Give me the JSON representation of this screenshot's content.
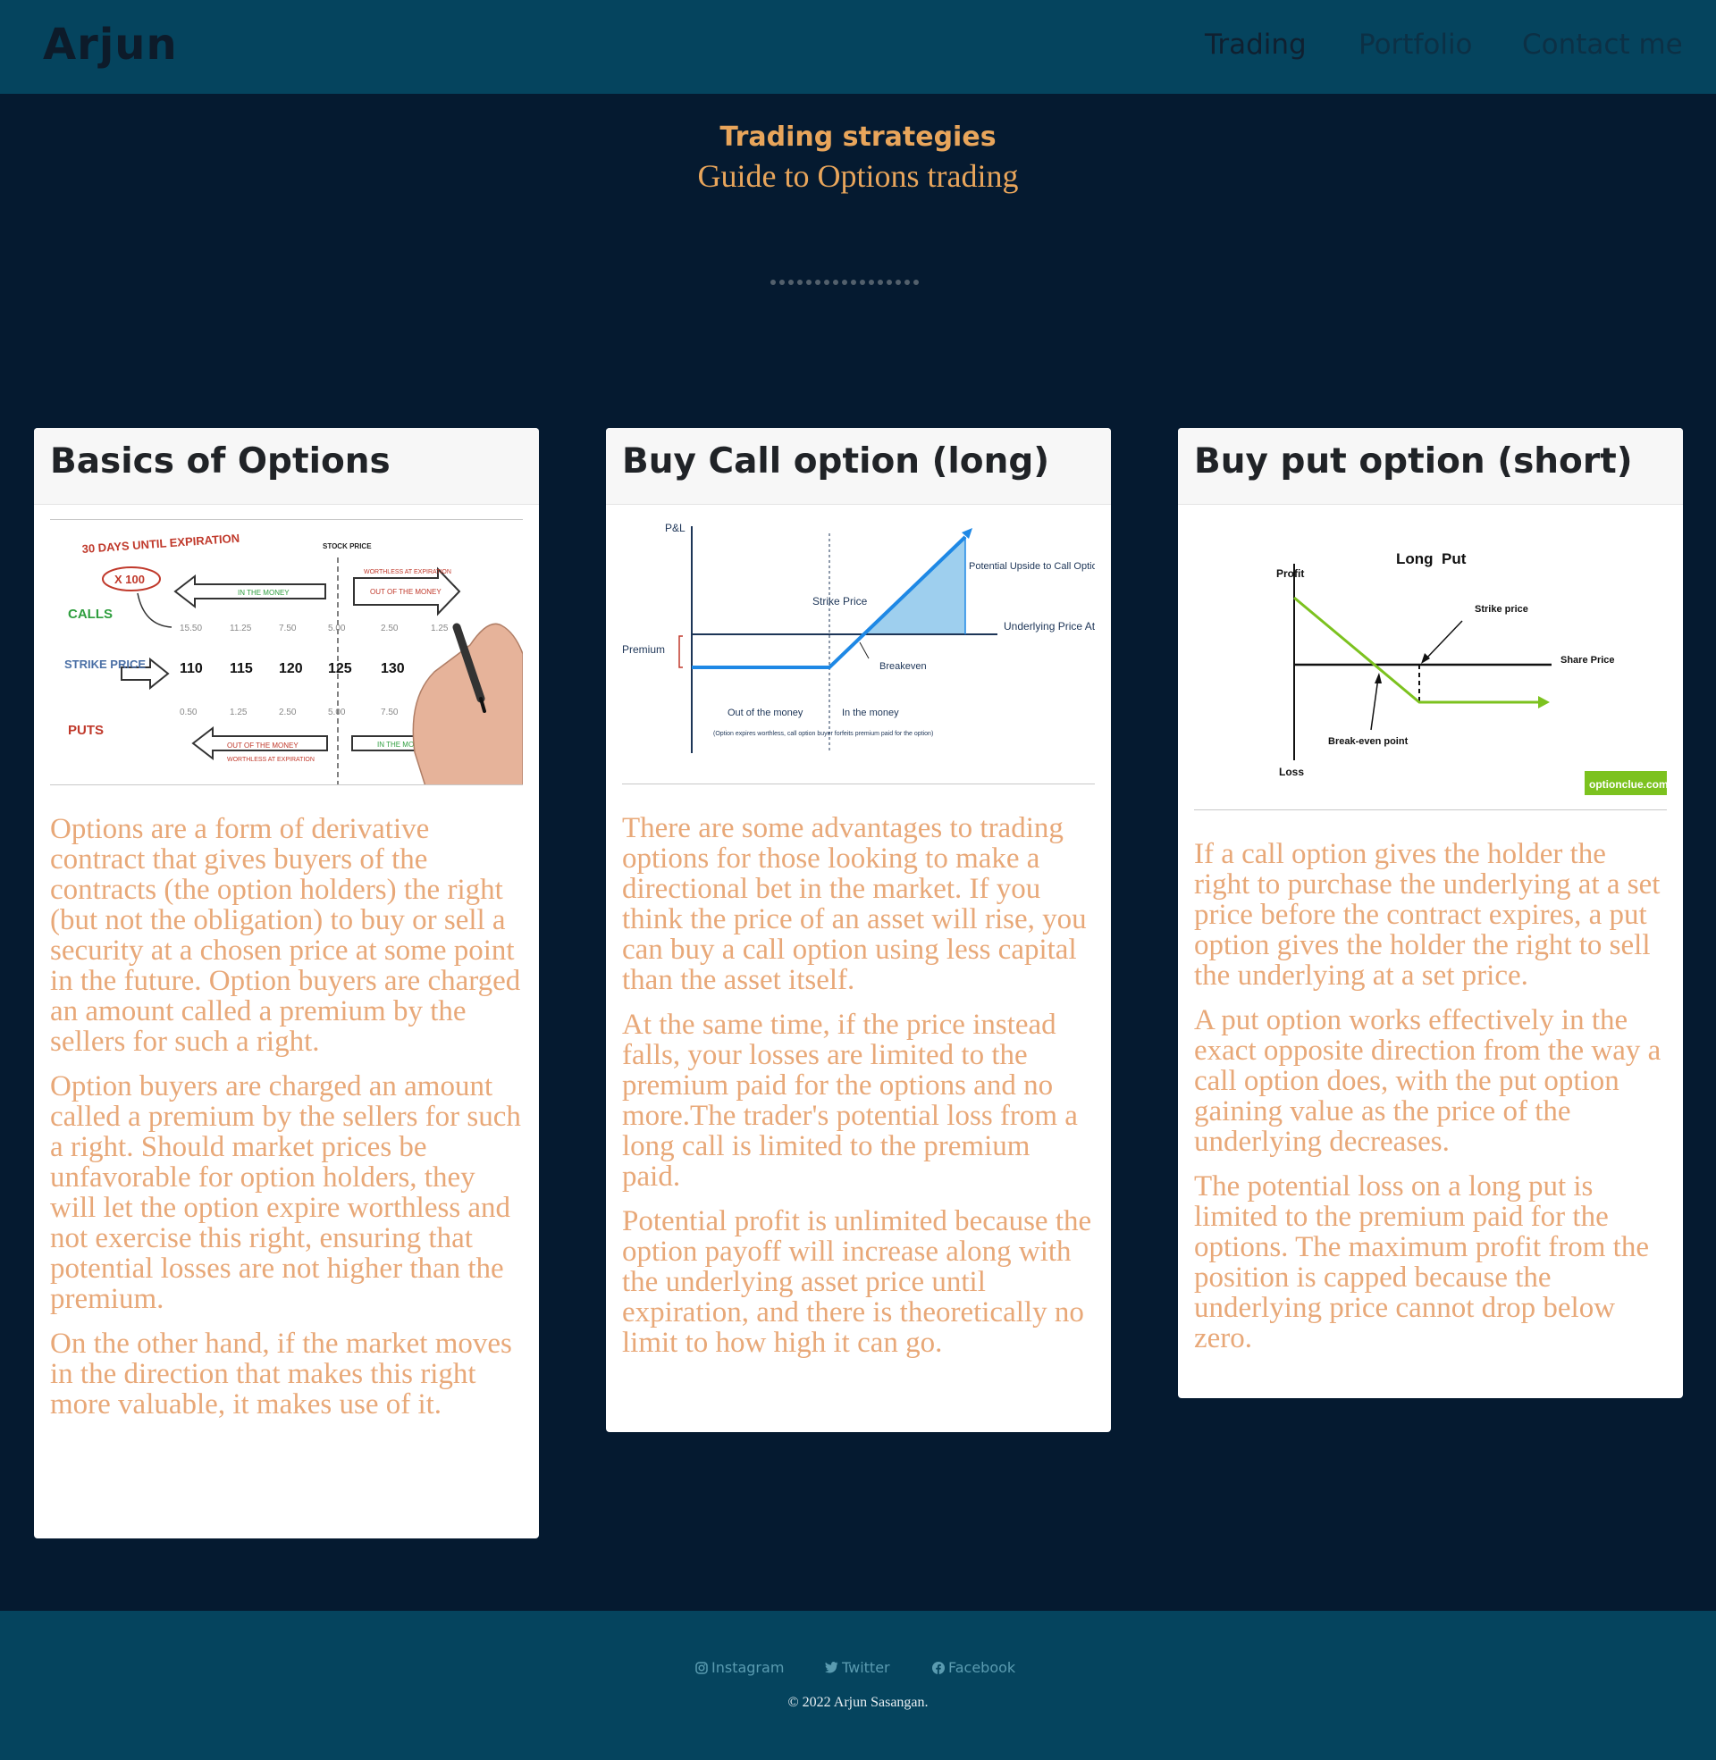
{
  "nav": {
    "brand": "Arjun",
    "links": [
      "Trading",
      "Portfolio",
      "Contact me"
    ]
  },
  "hero": {
    "title": "Trading strategies",
    "subtitle": "Guide to Options trading"
  },
  "cards": [
    {
      "title": "Basics of Options",
      "figure": {
        "heading": "30 DAYS UNTIL EXPIRATION",
        "multiplier": "X 100",
        "stock_price": "STOCK PRICE",
        "calls": "CALLS",
        "strike_price": "STRIKE PRICE",
        "puts": "PUTS",
        "in_the_money": "IN THE MONEY",
        "out_of_the_money": "OUT OF THE MONEY",
        "worthless": "WORTHLESS AT EXPIRATION",
        "call_prices": [
          "15.50",
          "11.25",
          "7.50",
          "5.00",
          "2.50",
          "1.25"
        ],
        "strikes": [
          "110",
          "115",
          "120",
          "125",
          "130"
        ],
        "put_prices": [
          "0.50",
          "1.25",
          "2.50",
          "5.00",
          "7.50"
        ]
      },
      "paragraphs": [
        "Options are a form of derivative contract that gives buyers of the contracts (the option holders) the right (but not the obligation) to buy or sell a security at a chosen price at some point in the future. Option buyers are charged an amount called a premium by the sellers for such a right.",
        "Option buyers are charged an amount called a premium by the sellers for such a right. Should market prices be unfavorable for option holders, they will let the option expire worthless and not exercise this right, ensuring that potential losses are not higher than the premium.",
        "On the other hand, if the market moves in the direction that makes this right more valuable, it makes use of it."
      ]
    },
    {
      "title": "Buy Call option (long)",
      "figure": {
        "pl": "P&L",
        "strike": "Strike Price",
        "premium": "Premium",
        "upside": "Potential Upside to Call Option Buyer",
        "underlying": "Underlying Price At Expiration",
        "breakeven": "Breakeven",
        "otm": "Out of the money",
        "itm": "In the money",
        "note": "(Option expires worthless, call option buyer forfeits premium paid for the option)"
      },
      "paragraphs": [
        "There are some advantages to trading options for those looking to make a directional bet in the market. If you think the price of an asset will rise, you can buy a call option using less capital than the asset itself.",
        "At the same time, if the price instead falls, your losses are limited to the premium paid for the options and no more.The trader's potential loss from a long call is limited to the premium paid.",
        "Potential profit is unlimited because the option payoff will increase along with the underlying asset price until expiration, and there is theoretically no limit to how high it can go."
      ]
    },
    {
      "title": "Buy put option (short)",
      "figure": {
        "title": "Long  Put",
        "profit": "Profit",
        "loss": "Loss",
        "strike": "Strike price",
        "share": "Share Price",
        "breakeven": "Break-even point",
        "source": "optionclue.com"
      },
      "paragraphs": [
        "If a call option gives the holder the right to purchase the underlying at a set price before the contract expires, a put option gives the holder the right to sell the underlying at a set price.",
        "A put option works effectively in the exact opposite direction from the way a call option does, with the put option gaining value as the price of the underlying decreases.",
        "The potential loss on a long put is limited to the premium paid for the options. The maximum profit from the position is capped because the underlying price cannot drop below zero."
      ]
    }
  ],
  "footer": {
    "instagram": "Instagram",
    "twitter": "Twitter",
    "facebook": "Facebook",
    "copyright": "© 2022 Arjun Sasangan."
  },
  "colors": {
    "navbar": "#05445e",
    "background": "#051a30",
    "accent": "#e8a55b"
  }
}
